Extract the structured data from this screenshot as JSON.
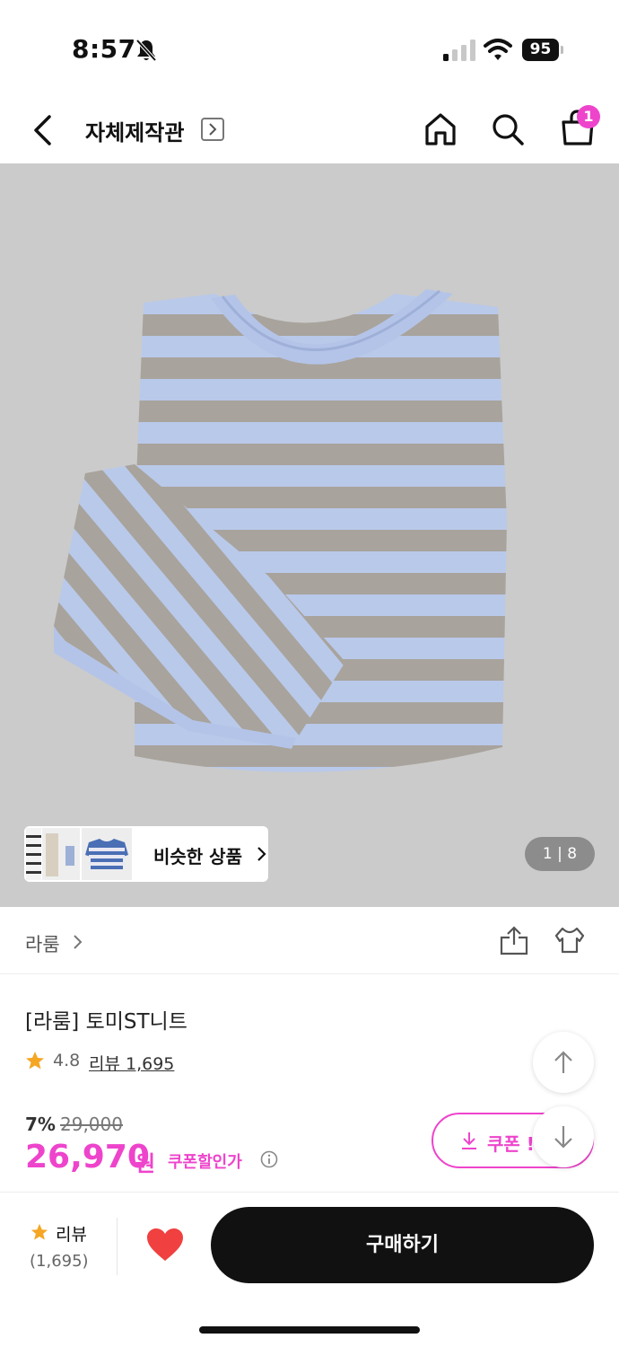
{
  "status": {
    "time": "8:57",
    "battery": "95"
  },
  "header": {
    "store_title": "자체제작관",
    "cart_count": "1"
  },
  "gallery": {
    "similar_label": "비슷한 상품",
    "counter": "1 | 8"
  },
  "brand": {
    "name": "라룸"
  },
  "product": {
    "title": "[라룸] 토미ST니트",
    "rating": "4.8",
    "review_link": "리뷰 1,695",
    "discount": "7%",
    "original_price": "29,000",
    "price": "26,970",
    "price_unit": "원",
    "coupon_price_label": "쿠폰할인가",
    "coupon_button": "쿠폰 !"
  },
  "bottom_bar": {
    "review_label": "리뷰",
    "review_count": "(1,695)",
    "buy_label": "구매하기"
  },
  "colors": {
    "accent": "#ee44cc",
    "buy_button": "#111111",
    "heart": "#f04040",
    "star": "#f5a623"
  }
}
